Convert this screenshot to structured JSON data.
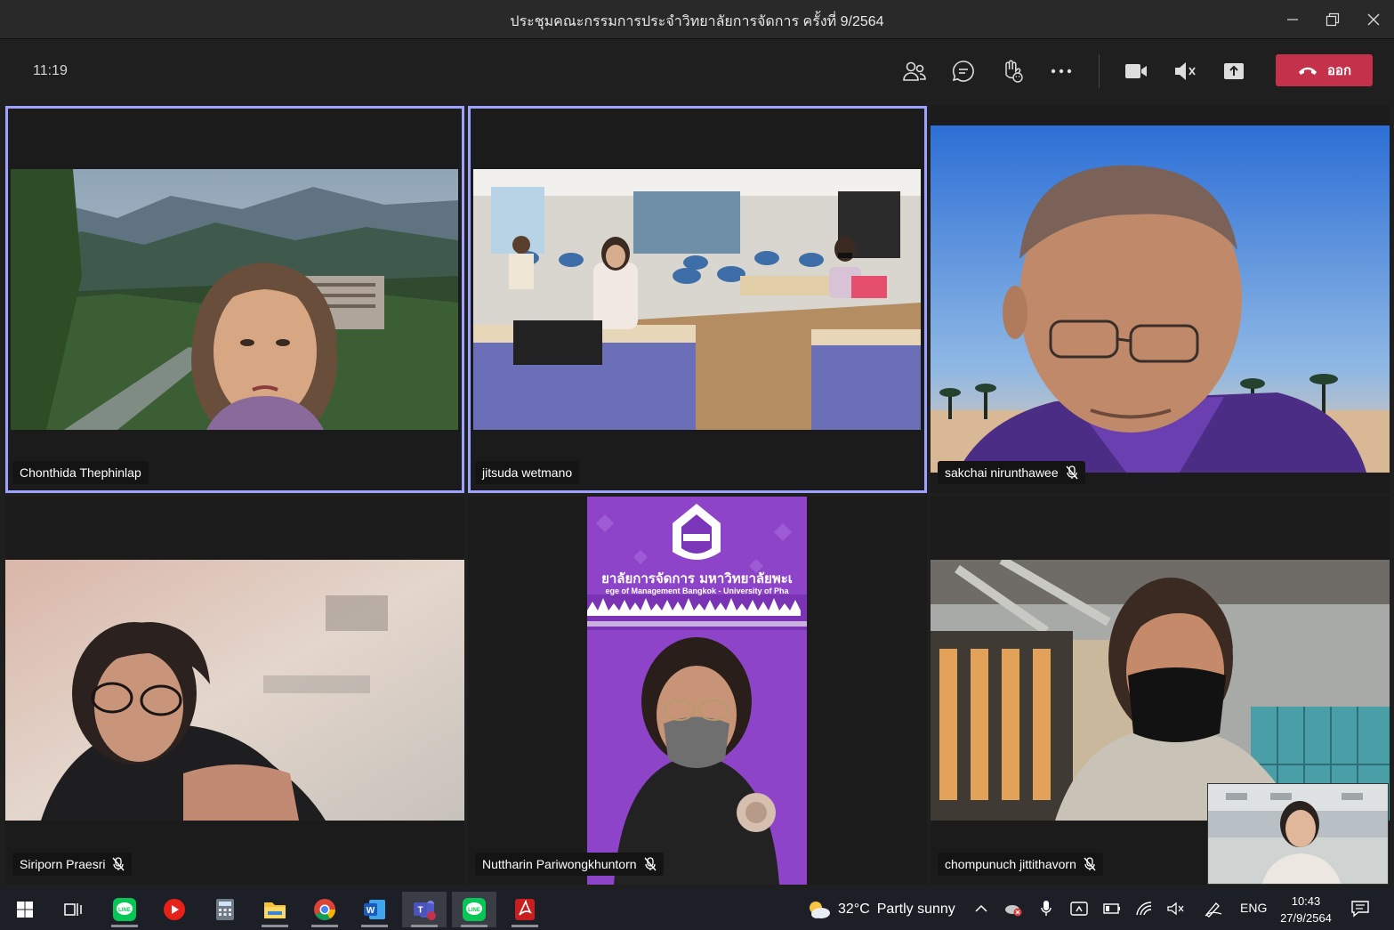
{
  "window": {
    "title": "ประชุมคณะกรรมการประจำวิทยาลัยการจัดการ ครั้งที่ 9/2564"
  },
  "toolbar": {
    "timer": "11:19",
    "leave_label": "ออก",
    "icons": [
      "people-icon",
      "chat-icon",
      "raise-hand-icon",
      "more-icon",
      "camera-icon",
      "mic-muted-icon",
      "share-icon"
    ]
  },
  "participants": [
    {
      "name": "Chonthida Thephinlap",
      "muted": false,
      "active": true
    },
    {
      "name": "jitsuda wetmano",
      "muted": false,
      "active": true
    },
    {
      "name": "sakchai nirunthawee",
      "muted": true,
      "active": false
    },
    {
      "name": "Siriporn Praesri",
      "muted": true,
      "active": false
    },
    {
      "name": "Nuttharin Pariwongkhuntorn",
      "muted": true,
      "active": false
    },
    {
      "name": "chompunuch jittithavorn",
      "muted": true,
      "active": false
    }
  ],
  "background_banner": {
    "line1": "ยาลัยการจัดการ มหาวิทยาลัยพะเ",
    "line2": "ege of Management Bangkok - University of Pha"
  },
  "taskbar": {
    "weather_temp": "32°C",
    "weather_text": "Partly sunny",
    "language": "ENG",
    "time": "10:43",
    "date": "27/9/2564",
    "apps": [
      "start-icon",
      "task-view-icon",
      "line-icon",
      "youtube-icon",
      "calculator-icon",
      "file-explorer-icon",
      "chrome-icon",
      "word-icon",
      "teams-icon",
      "line-icon",
      "acrobat-icon"
    ]
  },
  "colors": {
    "accent_outline": "#9ea2ff",
    "leave_button": "#c4314b",
    "banner_purple": "#8d44c9"
  }
}
